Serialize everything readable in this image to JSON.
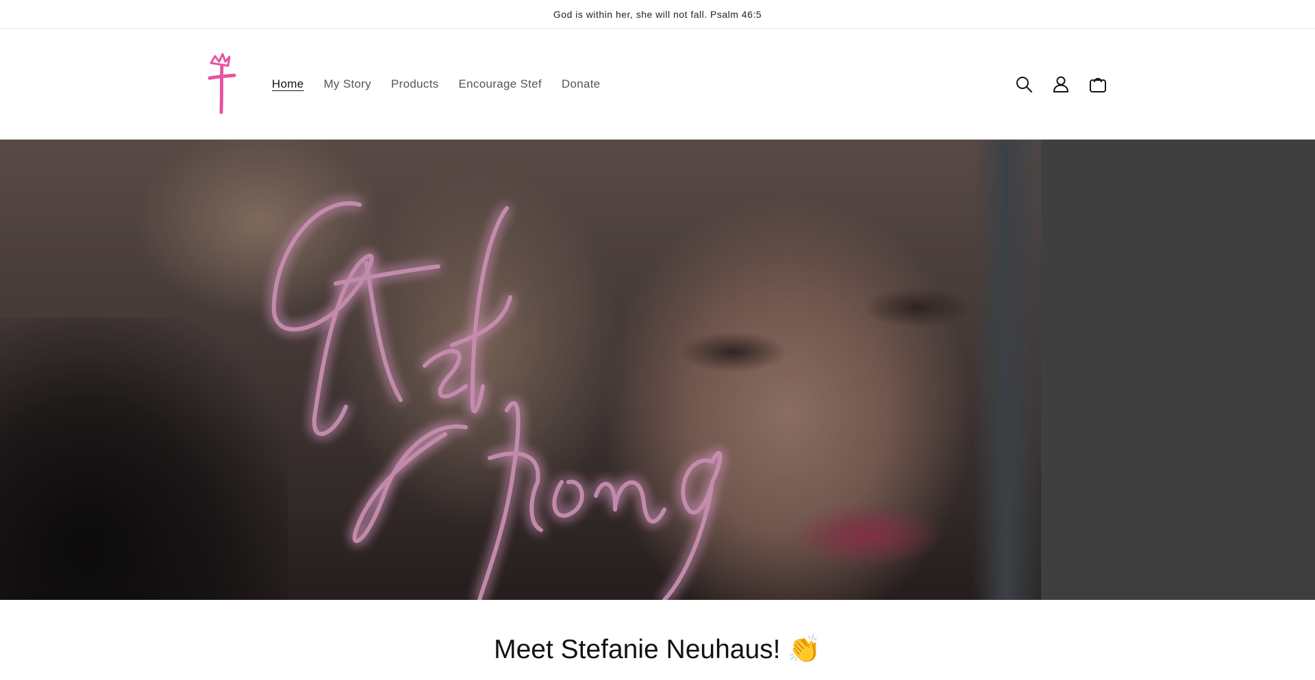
{
  "announcement": {
    "text": "God is within her, she will not fall. Psalm 46:5"
  },
  "header": {
    "logo_icon": "pink-cross-crown-logo",
    "nav": [
      {
        "label": "Home",
        "active": true
      },
      {
        "label": "My Story",
        "active": false
      },
      {
        "label": "Products",
        "active": false
      },
      {
        "label": "Encourage Stef",
        "active": false
      },
      {
        "label": "Donate",
        "active": false
      }
    ],
    "icons": [
      "search-icon",
      "account-icon",
      "cart-icon"
    ]
  },
  "hero": {
    "script_line_1": "Stef",
    "script_line_2": "Strong",
    "accent_color": "#e8549e"
  },
  "intro": {
    "heading": "Meet Stefanie Neuhaus! 👏"
  }
}
